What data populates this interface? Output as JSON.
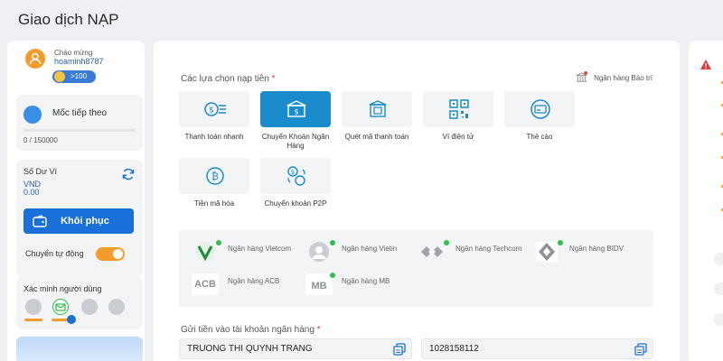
{
  "page": {
    "title": "Giao dịch NẠP"
  },
  "sidebar": {
    "welcome": "Chào mừng",
    "username": "hoaminh8787",
    "vip_badge": ">100",
    "milestone_label": "Mốc tiếp theo",
    "milestone_value": "0 / 150000",
    "milestone_progress": 0,
    "balance_label": "Số Dư Ví",
    "balance_currency": "VND",
    "balance_value": "0.00",
    "restore_label": "Khôi phục",
    "auto_transfer_label": "Chuyển tự động",
    "auto_transfer_on": true,
    "verify_label": "Xác minh người dùng"
  },
  "main": {
    "options_label": "Các lựa chọn nạp tiền",
    "required_mark": "*",
    "maintenance_label": "Ngân hàng Bảo trì",
    "methods": [
      {
        "label": "Thanh toán nhanh",
        "icon": "cash-fast-icon",
        "active": false
      },
      {
        "label": "Chuyển Khoản Ngân Hàng",
        "icon": "bank-transfer-icon",
        "active": true
      },
      {
        "label": "Quét mã thanh toán",
        "icon": "scan-qr-bank-icon",
        "active": false
      },
      {
        "label": "Ví điện tử",
        "icon": "qr-wallet-icon",
        "active": false
      },
      {
        "label": "Thẻ cào",
        "icon": "card-icon",
        "active": false
      },
      {
        "label": "Tiền mã hóa",
        "icon": "bitcoin-icon",
        "active": false
      },
      {
        "label": "Chuyển khoản P2P",
        "icon": "p2p-transfer-icon",
        "active": false
      }
    ],
    "banks": [
      {
        "name": "Ngân hàng Vietcom",
        "logo": "vietcombank-logo"
      },
      {
        "name": "Ngân hàng Vietin",
        "logo": "vietinbank-logo"
      },
      {
        "name": "Ngân hàng Techcom",
        "logo": "techcombank-logo"
      },
      {
        "name": "Ngân hàng BIDV",
        "logo": "bidv-logo"
      },
      {
        "name": "Ngân hàng ACB",
        "logo": "acb-logo",
        "logo_text": "ACB"
      },
      {
        "name": "Ngân hàng MB",
        "logo": "mb-logo",
        "logo_text": "MB"
      }
    ],
    "deposit_label": "Gửi tiền vào tài khoản ngân hàng",
    "account_name": "TRUONG THI QUYNH TRANG",
    "account_number": "1028158112"
  },
  "colors": {
    "accent": "#1a8ccc",
    "primary_button": "#1a6fd8",
    "orange": "#f39c2b",
    "status_green": "#2ec14a"
  }
}
